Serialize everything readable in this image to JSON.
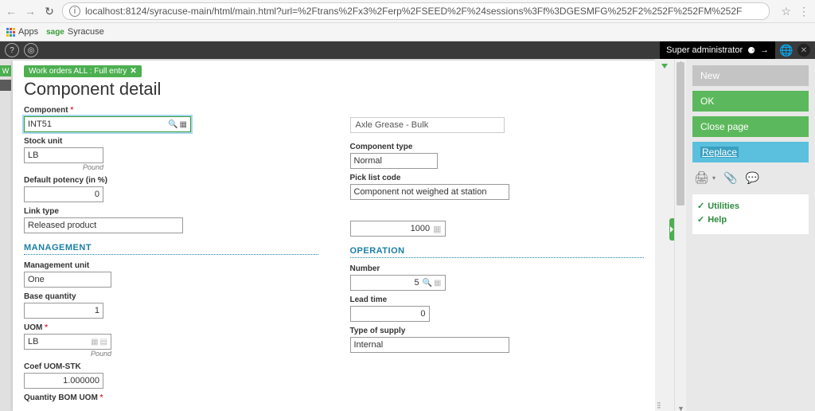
{
  "browser": {
    "url": "localhost:8124/syracuse-main/html/main.html?url=%2Ftrans%2Fx3%2Ferp%2FSEED%2F%24sessions%3Ff%3DGESMFG%252F2%252F%252FM%252F",
    "apps_label": "Apps",
    "bookmark1_brand": "sage",
    "bookmark1_label": "Syracuse"
  },
  "topbar": {
    "user": "Super administrator"
  },
  "tag": {
    "label": "Work orders ALL : Full entry"
  },
  "page_title": "Component detail",
  "left": {
    "component_lbl": "Component",
    "component_val": "INT51",
    "component_desc": "Axle Grease - Bulk",
    "stock_unit_lbl": "Stock unit",
    "stock_unit_val": "LB",
    "stock_unit_hint": "Pound",
    "potency_lbl": "Default potency (in %)",
    "potency_val": "0",
    "link_type_lbl": "Link type",
    "link_type_val": "Released product",
    "mgmt_head": "MANAGEMENT",
    "mgmt_unit_lbl": "Management unit",
    "mgmt_unit_val": "One",
    "base_qty_lbl": "Base quantity",
    "base_qty_val": "1",
    "uom_lbl": "UOM",
    "uom_val": "LB",
    "uom_hint": "Pound",
    "coef_lbl": "Coef UOM-STK",
    "coef_val": "1.000000",
    "qty_bom_lbl": "Quantity BOM UOM"
  },
  "right": {
    "comp_type_lbl": "Component type",
    "comp_type_val": "Normal",
    "pick_lbl": "Pick list code",
    "pick_val": "Component not weighed at station",
    "pick_qty": "1000",
    "op_head": "OPERATION",
    "number_lbl": "Number",
    "number_val": "5",
    "lead_lbl": "Lead time",
    "lead_val": "0",
    "supply_lbl": "Type of supply",
    "supply_val": "Internal"
  },
  "sidebar": {
    "new": "New",
    "ok": "OK",
    "close": "Close page",
    "replace": "Replace",
    "utilities": "Utilities",
    "help": "Help"
  }
}
